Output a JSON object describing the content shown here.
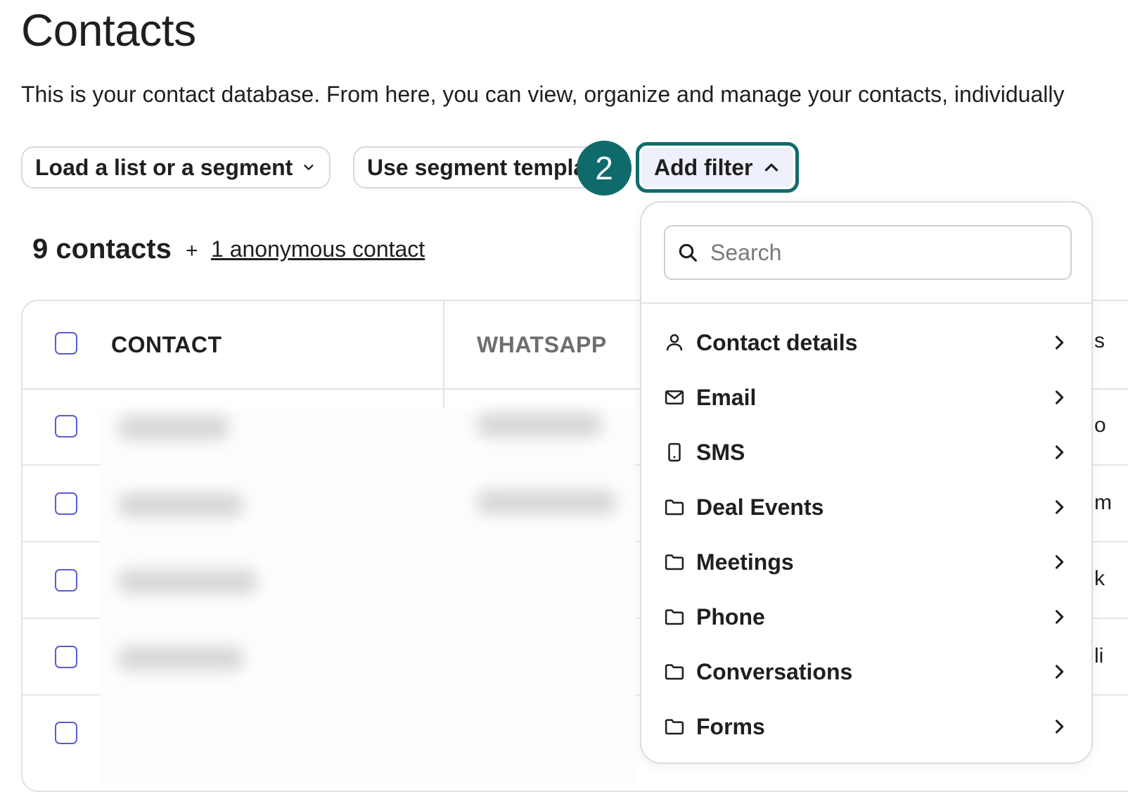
{
  "page": {
    "title": "Contacts",
    "description": "This is your contact database. From here, you can view, organize and manage your contacts, individually"
  },
  "toolbar": {
    "load_label": "Load a list or a segment",
    "template_label": "Use segment template",
    "add_filter_label": "Add filter",
    "step_badge": "2"
  },
  "summary": {
    "count": "9 contacts",
    "plus": "+",
    "anonymous_link": "1 anonymous contact"
  },
  "table": {
    "columns": [
      "CONTACT",
      "WHATSAPP"
    ],
    "row_count_visible": 5
  },
  "filter_dropdown": {
    "search_placeholder": "Search",
    "items": [
      {
        "label": "Contact details",
        "icon": "person-icon"
      },
      {
        "label": "Email",
        "icon": "envelope-icon"
      },
      {
        "label": "SMS",
        "icon": "phone-device-icon"
      },
      {
        "label": "Deal Events",
        "icon": "folder-icon"
      },
      {
        "label": "Meetings",
        "icon": "folder-icon"
      },
      {
        "label": "Phone",
        "icon": "folder-icon"
      },
      {
        "label": "Conversations",
        "icon": "folder-icon"
      },
      {
        "label": "Forms",
        "icon": "folder-icon"
      }
    ]
  },
  "colors": {
    "accent_teal": "#0f6b6b",
    "checkbox_border": "#5b5bd6",
    "add_filter_bg": "#eef0fb"
  },
  "right_peek": [
    "s",
    "o",
    "m",
    "k",
    "li"
  ]
}
